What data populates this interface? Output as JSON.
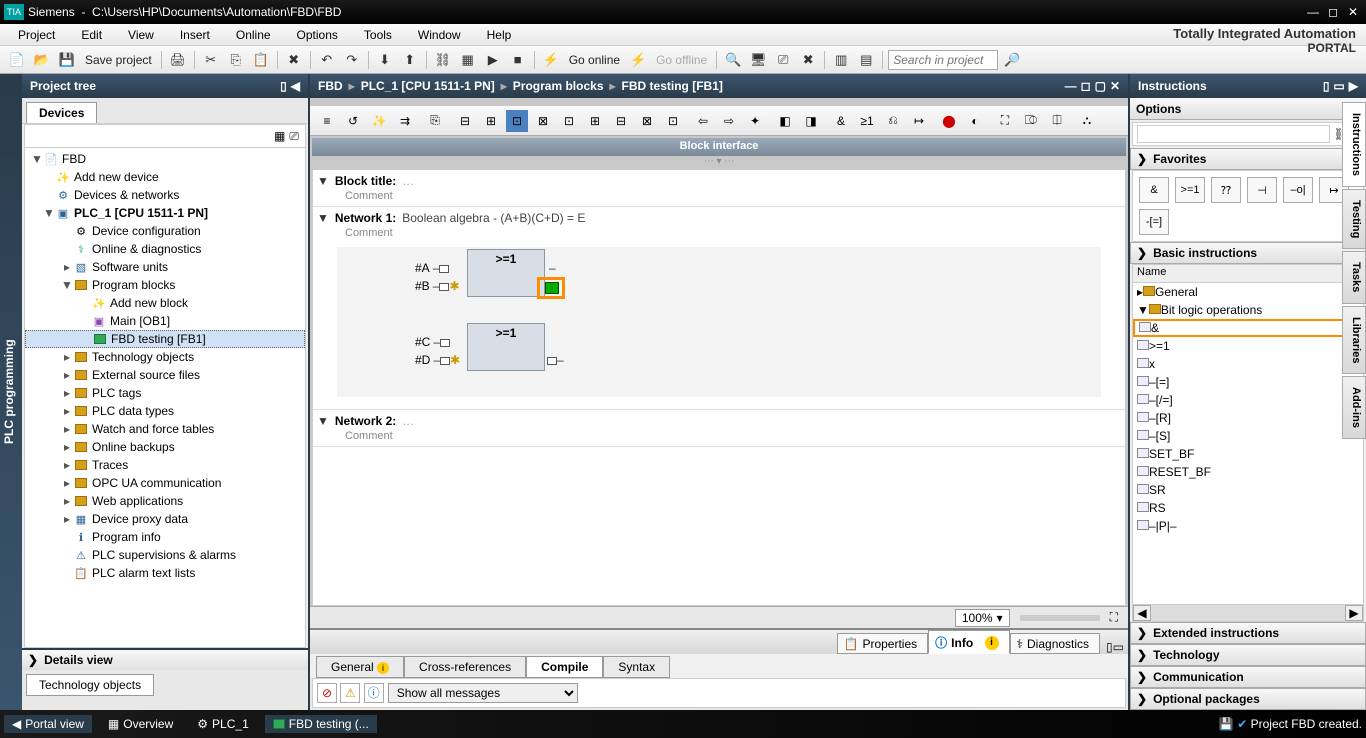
{
  "titlebar": {
    "app": "Siemens",
    "path": "C:\\Users\\HP\\Documents\\Automation\\FBD\\FBD"
  },
  "menu": [
    "Project",
    "Edit",
    "View",
    "Insert",
    "Online",
    "Options",
    "Tools",
    "Window",
    "Help"
  ],
  "branding": {
    "l1": "Totally Integrated Automation",
    "l2": "PORTAL"
  },
  "toolbar": {
    "save": "Save project",
    "go_online": "Go online",
    "go_offline": "Go offline",
    "search_placeholder": "Search in project"
  },
  "left": {
    "title": "Project tree",
    "devices_tab": "Devices",
    "tree": {
      "root": "FBD",
      "add_device": "Add new device",
      "dev_net": "Devices & networks",
      "plc": "PLC_1 [CPU 1511-1 PN]",
      "dev_cfg": "Device configuration",
      "online_diag": "Online & diagnostics",
      "sw_units": "Software units",
      "prog_blocks": "Program blocks",
      "add_block": "Add new block",
      "main_ob": "Main [OB1]",
      "fbd_test": "FBD testing [FB1]",
      "tech_obj": "Technology objects",
      "ext_src": "External source files",
      "plc_tags": "PLC tags",
      "plc_dtypes": "PLC data types",
      "watch": "Watch and force tables",
      "backups": "Online backups",
      "traces": "Traces",
      "opcua": "OPC UA communication",
      "webapps": "Web applications",
      "proxy": "Device proxy data",
      "proginfo": "Program info",
      "supervise": "PLC supervisions & alarms",
      "alarmtxt": "PLC alarm text lists"
    },
    "details": "Details view",
    "tech_tab": "Technology objects"
  },
  "vert_left": "PLC programming",
  "center": {
    "crumb": [
      "FBD",
      "PLC_1 [CPU 1511-1 PN]",
      "Program blocks",
      "FBD testing [FB1]"
    ],
    "block_interface": "Block interface",
    "block_title": "Block title:",
    "comment": "Comment",
    "net1": {
      "title": "Network 1:",
      "desc": "Boolean algebra - (A+B)(C+D) = E"
    },
    "net2": {
      "title": "Network 2:"
    },
    "pins": {
      "a": "#A",
      "b": "#B",
      "c": "#C",
      "d": "#D"
    },
    "op": ">=1",
    "zoom": "100%"
  },
  "info": {
    "properties": "Properties",
    "info": "Info",
    "diagnostics": "Diagnostics",
    "general": "General",
    "crossref": "Cross-references",
    "compile": "Compile",
    "syntax": "Syntax",
    "showall": "Show all messages"
  },
  "right": {
    "title": "Instructions",
    "options": "Options",
    "favorites": "Favorites",
    "fav_items": [
      "&",
      ">=1",
      "⁇",
      "⊣",
      "–o|",
      "↦",
      "-[=]"
    ],
    "basic": "Basic instructions",
    "name_col": "Name",
    "general": "General",
    "bitlogic": "Bit logic operations",
    "ops": [
      "&",
      ">=1",
      "x",
      "–[=]",
      "–[/=]",
      "–[R]",
      "–[S]",
      "SET_BF",
      "RESET_BF",
      "SR",
      "RS",
      "–|P|–"
    ],
    "extended": "Extended instructions",
    "technology": "Technology",
    "communication": "Communication",
    "optional": "Optional packages"
  },
  "rside_tabs": [
    "Instructions",
    "Testing",
    "Tasks",
    "Libraries",
    "Add-ins"
  ],
  "status": {
    "portal": "Portal view",
    "overview": "Overview",
    "plc": "PLC_1",
    "fbd": "FBD testing (...",
    "msg": "Project FBD created."
  }
}
